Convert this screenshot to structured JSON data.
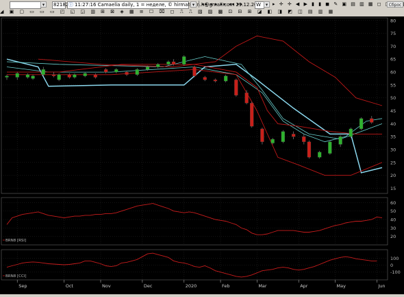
{
  "toolbar": {
    "symbol_value": "",
    "count_value": "82182",
    "status_text": "11:27:16  Camaelia daily, 1 = неделе, © hirmatullin.h@gmail.com 29.12.2014",
    "period_value": "W",
    "close_label": "Сброс"
  },
  "chart_data": {
    "type": "candlestick",
    "title": "",
    "xlabel": "",
    "ylabel": "",
    "ylim": [
      13,
      81
    ],
    "yticks": [
      15,
      20,
      25,
      30,
      35,
      40,
      45,
      50,
      55,
      60,
      65,
      70,
      75,
      80
    ],
    "x_labels": [
      "Sep",
      "Oct",
      "Nov",
      "Dec",
      "2020",
      "Feb",
      "Mar",
      "Apr",
      "May",
      "Jun"
    ],
    "x_label_index": [
      2,
      11,
      18,
      26,
      34,
      41,
      48,
      56,
      63,
      71
    ],
    "bar_count": 73,
    "grid": true,
    "candles": [
      {
        "i": 0,
        "o": 58,
        "c": 58.5,
        "h": 59,
        "l": 57
      },
      {
        "i": 2,
        "o": 58,
        "c": 59.5,
        "h": 60,
        "l": 57
      },
      {
        "i": 4,
        "o": 58,
        "c": 59,
        "h": 59.5,
        "l": 57.5
      },
      {
        "i": 5,
        "o": 57.5,
        "c": 58.5,
        "h": 59,
        "l": 57
      },
      {
        "i": 7,
        "o": 59,
        "c": 61,
        "h": 62,
        "l": 58.5
      },
      {
        "i": 9,
        "o": 59,
        "c": 58.5,
        "h": 60,
        "l": 58
      },
      {
        "i": 10,
        "o": 57,
        "c": 59,
        "h": 59.5,
        "l": 56.5
      },
      {
        "i": 12,
        "o": 59,
        "c": 58,
        "h": 59.5,
        "l": 57.5
      },
      {
        "i": 13,
        "o": 58,
        "c": 59,
        "h": 59.5,
        "l": 57.5
      },
      {
        "i": 15,
        "o": 58.5,
        "c": 59.5,
        "h": 60,
        "l": 58
      },
      {
        "i": 17,
        "o": 59,
        "c": 58,
        "h": 59.5,
        "l": 57.5
      },
      {
        "i": 19,
        "o": 61,
        "c": 60,
        "h": 61.5,
        "l": 59.5
      },
      {
        "i": 21,
        "o": 60,
        "c": 61,
        "h": 61.5,
        "l": 59.5
      },
      {
        "i": 23,
        "o": 60,
        "c": 59,
        "h": 60.5,
        "l": 58.5
      },
      {
        "i": 25,
        "o": 59,
        "c": 61,
        "h": 61.5,
        "l": 58.5
      },
      {
        "i": 27,
        "o": 61,
        "c": 62,
        "h": 62.5,
        "l": 60.5
      },
      {
        "i": 29,
        "o": 62,
        "c": 63,
        "h": 63.5,
        "l": 61.5
      },
      {
        "i": 31,
        "o": 63,
        "c": 64,
        "h": 64.5,
        "l": 62.5
      },
      {
        "i": 32,
        "o": 64,
        "c": 63,
        "h": 65,
        "l": 62.5
      },
      {
        "i": 34,
        "o": 63,
        "c": 66,
        "h": 66.5,
        "l": 62.5
      },
      {
        "i": 36,
        "o": 62,
        "c": 58.5,
        "h": 62.5,
        "l": 58
      },
      {
        "i": 38,
        "o": 58,
        "c": 57,
        "h": 58.5,
        "l": 56.5
      },
      {
        "i": 40,
        "o": 57,
        "c": 56.5,
        "h": 57.5,
        "l": 56
      },
      {
        "i": 42,
        "o": 56.5,
        "c": 58.5,
        "h": 59,
        "l": 56
      },
      {
        "i": 44,
        "o": 57,
        "c": 51,
        "h": 57.5,
        "l": 50.5
      },
      {
        "i": 46,
        "o": 52,
        "c": 48,
        "h": 53,
        "l": 47.5
      },
      {
        "i": 47,
        "o": 48,
        "c": 39,
        "h": 48.5,
        "l": 38.5
      },
      {
        "i": 49,
        "o": 38,
        "c": 33,
        "h": 38.5,
        "l": 32
      },
      {
        "i": 51,
        "o": 32.5,
        "c": 34,
        "h": 34.5,
        "l": 32
      },
      {
        "i": 53,
        "o": 33,
        "c": 37,
        "h": 37.5,
        "l": 32.5
      },
      {
        "i": 55,
        "o": 36,
        "c": 35,
        "h": 37,
        "l": 34
      },
      {
        "i": 57,
        "o": 35,
        "c": 33,
        "h": 36,
        "l": 32
      },
      {
        "i": 58,
        "o": 33,
        "c": 27,
        "h": 33.5,
        "l": 26.5
      },
      {
        "i": 60,
        "o": 27,
        "c": 29,
        "h": 29.5,
        "l": 26.5
      },
      {
        "i": 62,
        "o": 28.5,
        "c": 33,
        "h": 33.5,
        "l": 28
      },
      {
        "i": 64,
        "o": 32,
        "c": 35,
        "h": 35.5,
        "l": 31
      },
      {
        "i": 66,
        "o": 35,
        "c": 38,
        "h": 38.5,
        "l": 34.5
      },
      {
        "i": 68,
        "o": 38,
        "c": 42,
        "h": 42.5,
        "l": 37.5
      },
      {
        "i": 70,
        "o": 42,
        "c": 40.5,
        "h": 43,
        "l": 40
      }
    ],
    "series": [
      {
        "name": "",
        "color": "#8bd8ee",
        "width": 1.5,
        "points": [
          [
            0,
            65
          ],
          [
            6,
            62
          ],
          [
            8,
            54.5
          ],
          [
            20,
            55
          ],
          [
            34,
            55
          ],
          [
            38,
            62
          ],
          [
            44,
            63
          ],
          [
            48,
            57
          ],
          [
            55,
            46
          ],
          [
            62,
            36
          ],
          [
            66,
            36
          ],
          [
            68,
            21
          ],
          [
            72,
            23
          ]
        ]
      },
      {
        "name": "",
        "color": "#6ad0cf",
        "width": 0.8,
        "points": [
          [
            0,
            62
          ],
          [
            8,
            60
          ],
          [
            20,
            60
          ],
          [
            36,
            62
          ],
          [
            44,
            59
          ],
          [
            49,
            52
          ],
          [
            53,
            41
          ],
          [
            57,
            36
          ],
          [
            61,
            33
          ],
          [
            65,
            35
          ],
          [
            69,
            41
          ],
          [
            72,
            42
          ]
        ]
      },
      {
        "name": "",
        "color": "#6ad0cf",
        "width": 0.8,
        "points": [
          [
            0,
            64
          ],
          [
            10,
            63
          ],
          [
            30,
            62
          ],
          [
            38,
            66
          ],
          [
            45,
            63
          ],
          [
            49,
            53
          ],
          [
            53,
            42
          ],
          [
            58,
            36
          ],
          [
            64,
            34
          ],
          [
            68,
            37
          ],
          [
            72,
            40
          ]
        ]
      },
      {
        "name": "",
        "color": "#c01818",
        "width": 0.9,
        "points": [
          [
            0,
            60
          ],
          [
            10,
            60
          ],
          [
            22,
            63
          ],
          [
            36,
            63
          ],
          [
            44,
            60
          ],
          [
            48,
            54
          ],
          [
            50,
            45
          ],
          [
            52,
            40
          ],
          [
            56,
            39
          ],
          [
            62,
            37
          ],
          [
            67,
            36
          ],
          [
            72,
            36
          ]
        ]
      },
      {
        "name": "",
        "color": "#c01818",
        "width": 0.9,
        "points": [
          [
            0,
            59
          ],
          [
            20,
            59
          ],
          [
            36,
            61
          ],
          [
            44,
            59
          ],
          [
            48,
            45
          ],
          [
            52,
            27
          ],
          [
            56,
            24
          ],
          [
            61,
            20
          ],
          [
            66,
            20
          ],
          [
            72,
            25
          ]
        ]
      },
      {
        "name": "",
        "color": "#c01818",
        "width": 0.9,
        "points": [
          [
            6,
            65
          ],
          [
            18,
            63
          ],
          [
            32,
            62
          ],
          [
            40,
            64
          ],
          [
            44,
            70
          ],
          [
            48,
            74
          ],
          [
            53,
            72
          ],
          [
            58,
            64
          ],
          [
            63,
            58
          ],
          [
            67,
            50
          ],
          [
            72,
            47
          ]
        ]
      }
    ],
    "rsi": {
      "label": "BRN8 [RSI]",
      "ylim": [
        10,
        66
      ],
      "yticks": [
        20,
        30,
        40,
        50,
        60
      ],
      "values": [
        34,
        42,
        44,
        46,
        47,
        48,
        49,
        47,
        45,
        44,
        43,
        42,
        43,
        44,
        44,
        45,
        45,
        46,
        46,
        47,
        47,
        48,
        50,
        52,
        54,
        56,
        57,
        58,
        59,
        57,
        55,
        53,
        50,
        49,
        48,
        49,
        48,
        46,
        44,
        42,
        40,
        39,
        38,
        36,
        34,
        30,
        28,
        24,
        22,
        22,
        23,
        25,
        27,
        27,
        27,
        27,
        26,
        25,
        25,
        26,
        27,
        29,
        31,
        33,
        34,
        36,
        37,
        38,
        38,
        39,
        40,
        43,
        42
      ]
    },
    "cci": {
      "label": "BRN8 [CCI]",
      "ylim": [
        -210,
        220
      ],
      "yticks": [
        100,
        0,
        -100
      ],
      "tick_labels": [
        "100",
        "0",
        "-100"
      ],
      "values": [
        -30,
        -10,
        10,
        30,
        40,
        45,
        40,
        30,
        20,
        15,
        10,
        5,
        10,
        20,
        30,
        60,
        60,
        40,
        20,
        -10,
        -20,
        -10,
        30,
        40,
        60,
        80,
        120,
        160,
        170,
        150,
        130,
        110,
        60,
        40,
        30,
        10,
        -20,
        -30,
        -10,
        -40,
        -80,
        -100,
        -120,
        -140,
        -160,
        -170,
        -160,
        -140,
        -110,
        -80,
        -70,
        -60,
        -40,
        -30,
        -40,
        -60,
        -70,
        -60,
        -40,
        -20,
        10,
        40,
        70,
        90,
        110,
        120,
        110,
        90,
        80,
        70,
        60,
        60
      ]
    }
  }
}
